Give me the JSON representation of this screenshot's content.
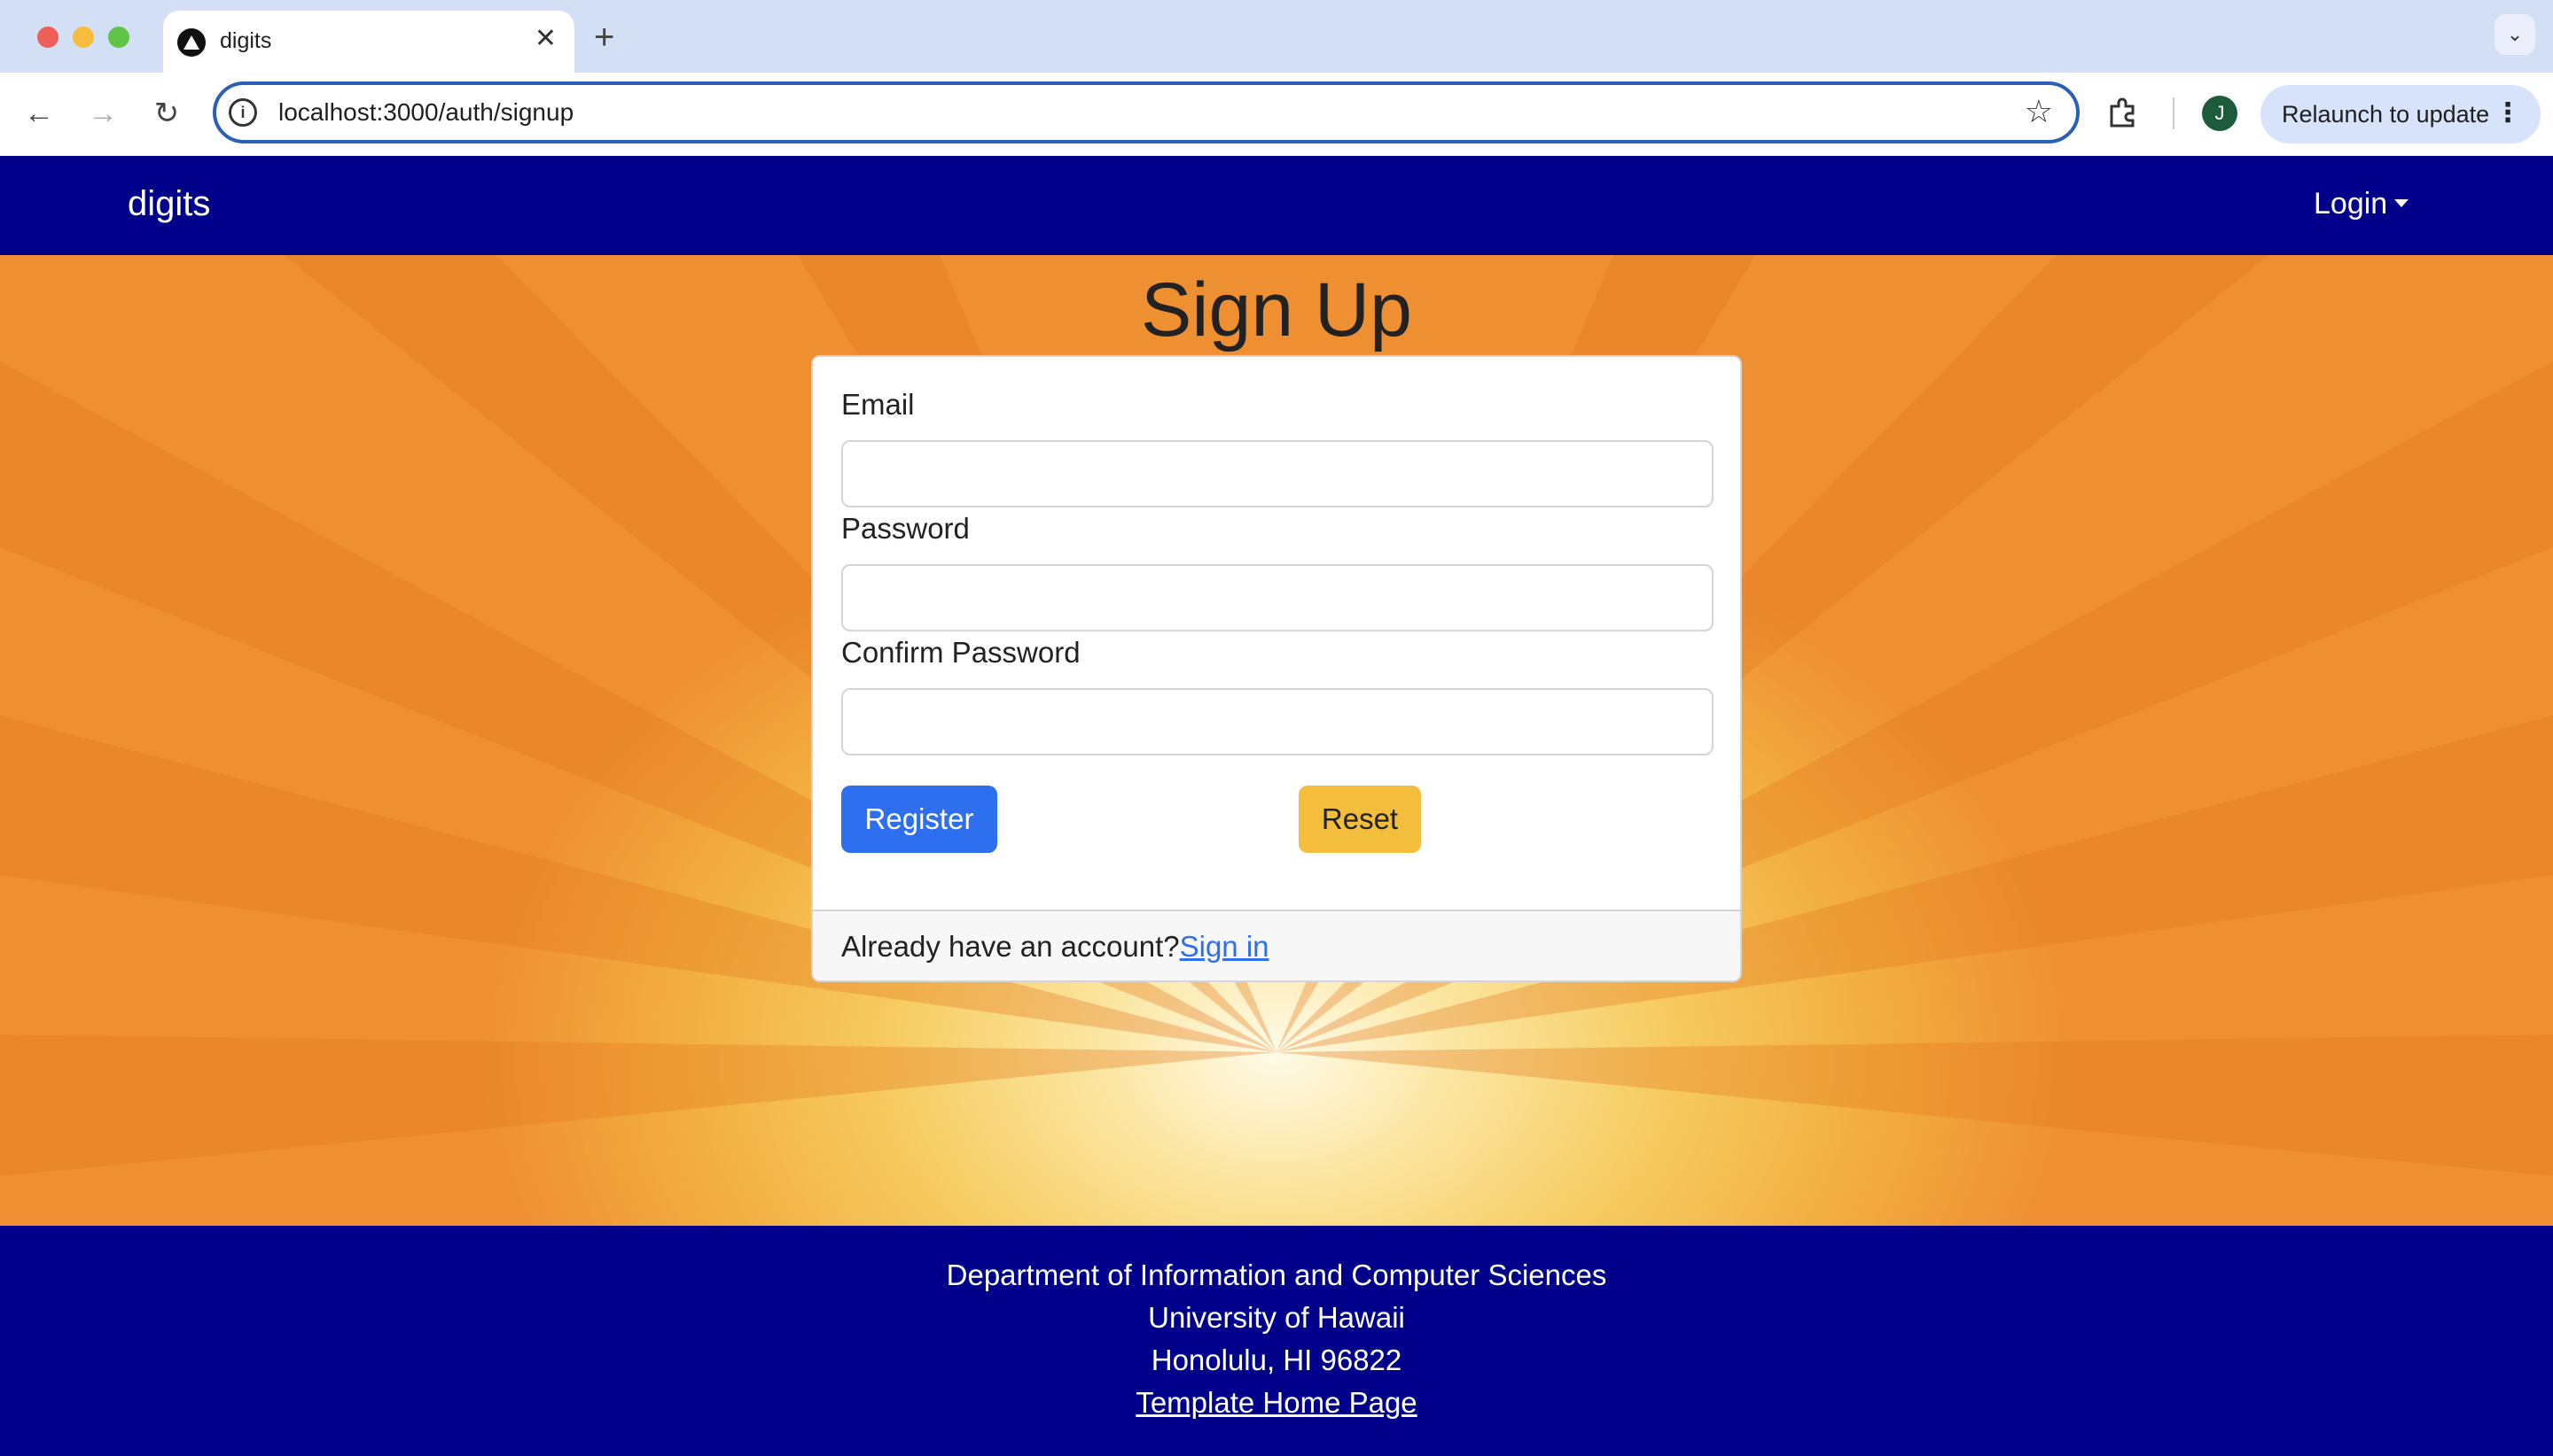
{
  "browser": {
    "tab_title": "digits",
    "url": "localhost:3000/auth/signup",
    "new_tab_label": "+",
    "profile_initial": "J",
    "relaunch_label": "Relaunch to update"
  },
  "navbar": {
    "brand": "digits",
    "login_label": "Login"
  },
  "signup": {
    "heading": "Sign Up",
    "email_label": "Email",
    "password_label": "Password",
    "confirm_label": "Confirm Password",
    "email_value": "",
    "password_value": "",
    "confirm_value": "",
    "register_label": "Register",
    "reset_label": "Reset",
    "account_prompt": "Already have an account?",
    "signin_label": "Sign in"
  },
  "footer": {
    "line1": "Department of Information and Computer Sciences",
    "line2": "University of Hawaii",
    "line3": "Honolulu, HI 96822",
    "link": "Template Home Page"
  },
  "colors": {
    "navbar": "#00008b",
    "register": "#2e6ff0",
    "reset": "#f2be3b",
    "omnibox_border": "#2c5fb8"
  },
  "icons": [
    "back-arrow-icon",
    "forward-arrow-icon",
    "reload-icon",
    "info-icon",
    "star-icon",
    "extensions-icon",
    "more-vert-icon",
    "close-icon",
    "tab-list-icon"
  ]
}
